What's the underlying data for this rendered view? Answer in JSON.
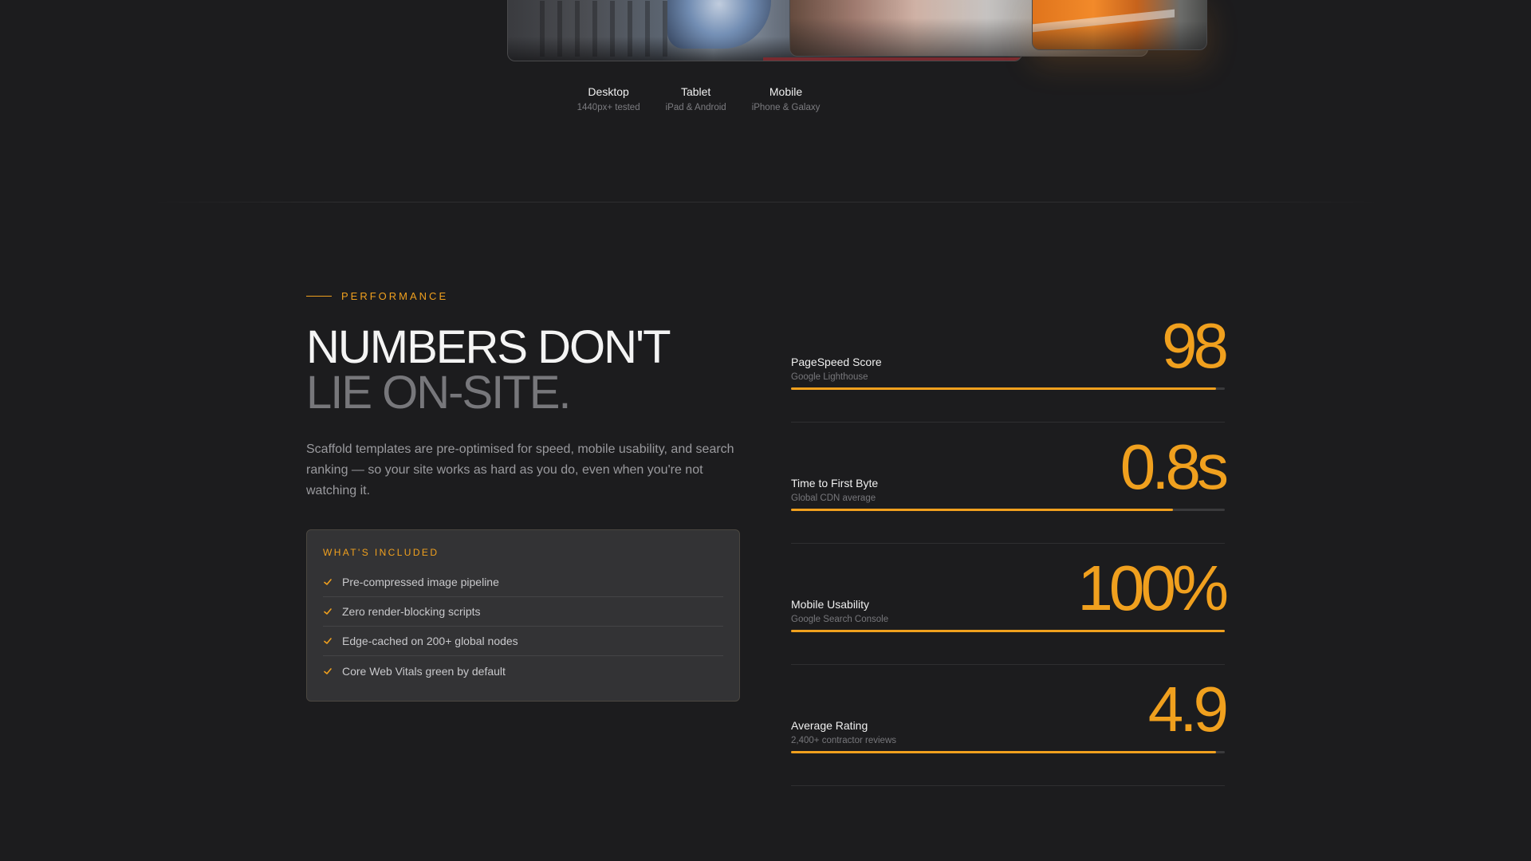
{
  "devices": [
    {
      "title": "Desktop",
      "subtitle": "1440px+ tested"
    },
    {
      "title": "Tablet",
      "subtitle": "iPad & Android"
    },
    {
      "title": "Mobile",
      "subtitle": "iPhone & Galaxy"
    }
  ],
  "performance": {
    "eyebrow": "PERFORMANCE",
    "headline_line1": "NUMBERS DON'T",
    "headline_line2": "LIE ON-SITE.",
    "intro": "Scaffold templates are pre-optimised for speed, mobile usability, and search ranking — so your site works as hard as you do, even when you're not watching it."
  },
  "included": {
    "title": "WHAT'S INCLUDED",
    "items": [
      "Pre-compressed image pipeline",
      "Zero render-blocking scripts",
      "Edge-cached on 200+ global nodes",
      "Core Web Vitals green by default"
    ]
  },
  "stats": [
    {
      "label": "PageSpeed Score",
      "sub": "Google Lighthouse",
      "value": "98",
      "progress": 0.98
    },
    {
      "label": "Time to First Byte",
      "sub": "Global CDN average",
      "value": "0.8s",
      "progress": 0.88
    },
    {
      "label": "Mobile Usability",
      "sub": "Google Search Console",
      "value": "100%",
      "progress": 1.0
    },
    {
      "label": "Average Rating",
      "sub": "2,400+ contractor reviews",
      "value": "4.9",
      "progress": 0.98
    }
  ],
  "colors": {
    "accent": "#f0a01e",
    "background": "#1c1c1e"
  }
}
